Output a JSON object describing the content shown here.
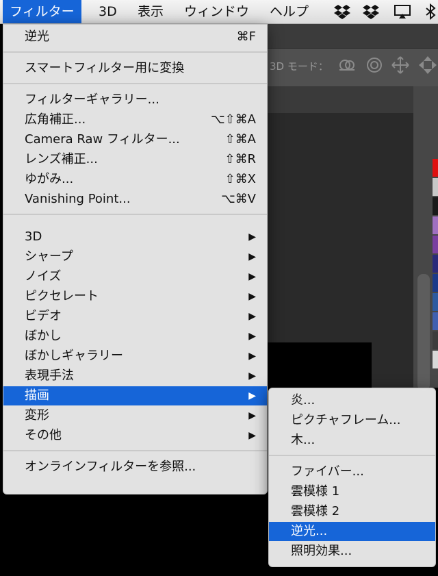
{
  "menubar": {
    "items": [
      {
        "label": "フィルター",
        "active": true
      },
      {
        "label": "3D"
      },
      {
        "label": "表示"
      },
      {
        "label": "ウィンドウ"
      },
      {
        "label": "ヘルプ"
      }
    ],
    "status_icons": [
      "dropbox-icon",
      "dropbox-icon",
      "airplay-icon",
      "bluetooth-icon"
    ]
  },
  "photoshop": {
    "options_label": "3D モード：",
    "option_icons": [
      "orbit-3d-icon",
      "roll-3d-icon",
      "pan-3d-icon",
      "slide-3d-icon"
    ]
  },
  "filter_menu": {
    "groups": [
      [
        {
          "label": "逆光",
          "shortcut": "⌘F"
        }
      ],
      [
        {
          "label": "スマートフィルター用に変換",
          "shortcut": ""
        }
      ],
      [
        {
          "label": "フィルターギャラリー...",
          "shortcut": ""
        },
        {
          "label": "広角補正...",
          "shortcut": "⌥⇧⌘A"
        },
        {
          "label": "Camera Raw フィルター...",
          "shortcut": "⇧⌘A"
        },
        {
          "label": "レンズ補正...",
          "shortcut": "⇧⌘R"
        },
        {
          "label": "ゆがみ...",
          "shortcut": "⇧⌘X"
        },
        {
          "label": "Vanishing Point...",
          "shortcut": "⌥⌘V"
        }
      ],
      [
        {
          "label": "3D",
          "submenu": true
        },
        {
          "label": "シャープ",
          "submenu": true
        },
        {
          "label": "ノイズ",
          "submenu": true
        },
        {
          "label": "ピクセレート",
          "submenu": true
        },
        {
          "label": "ビデオ",
          "submenu": true
        },
        {
          "label": "ぼかし",
          "submenu": true
        },
        {
          "label": "ぼかしギャラリー",
          "submenu": true
        },
        {
          "label": "表現手法",
          "submenu": true
        },
        {
          "label": "描画",
          "submenu": true,
          "selected": true
        },
        {
          "label": "変形",
          "submenu": true
        },
        {
          "label": "その他",
          "submenu": true
        }
      ],
      [
        {
          "label": "オンラインフィルターを参照...",
          "shortcut": ""
        }
      ]
    ],
    "submenu_arrow": "▶"
  },
  "render_submenu": {
    "groups": [
      [
        {
          "label": "炎..."
        },
        {
          "label": "ピクチャフレーム..."
        },
        {
          "label": "木..."
        }
      ],
      [
        {
          "label": "ファイバー..."
        },
        {
          "label": "雲模様 1"
        },
        {
          "label": "雲模様 2"
        },
        {
          "label": "逆光...",
          "selected": true
        },
        {
          "label": "照明効果..."
        }
      ]
    ]
  },
  "colors": {
    "menu_highlight": "#1665d8",
    "menu_bg": "#e7e7e7",
    "swatches": [
      "#e01010",
      "#c8c8c8",
      "#1a1a1a",
      "#a070c0",
      "#7a3fa0",
      "#2a2a7a",
      "#1b3a8a",
      "#2d5aa0",
      "#4060b0",
      "#3c3c3c",
      "#d8d8d8"
    ]
  }
}
